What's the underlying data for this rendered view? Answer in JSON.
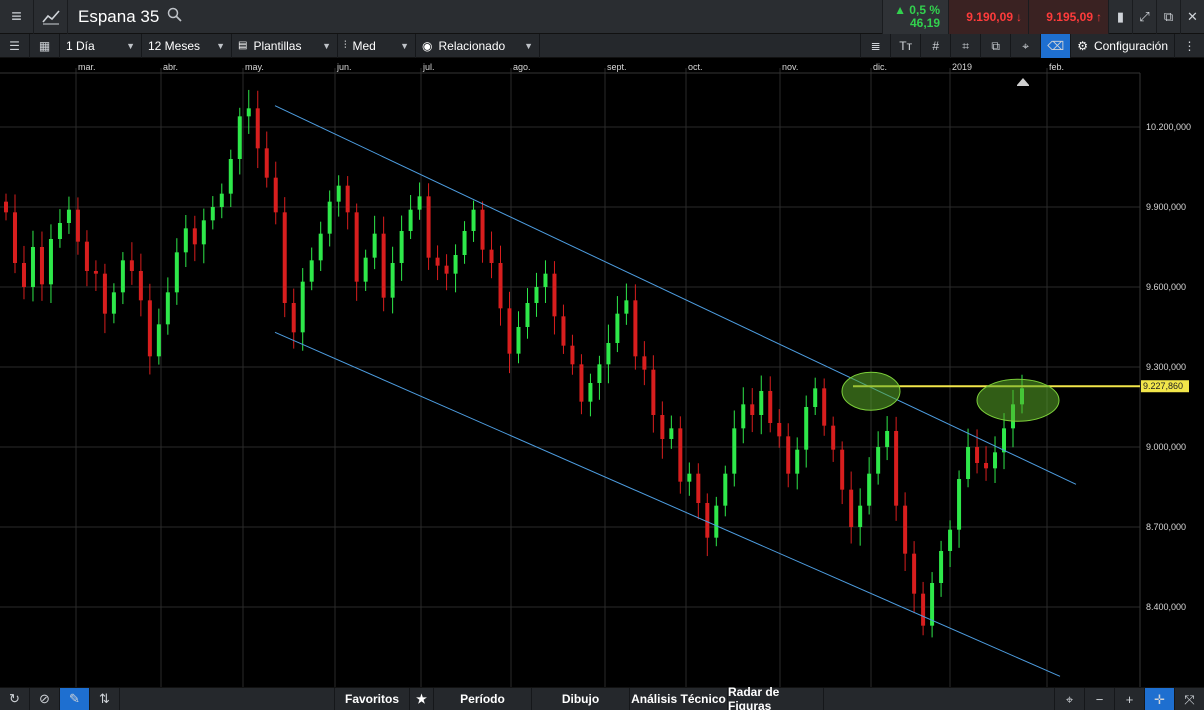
{
  "header": {
    "menu_icon": "hamburger-icon",
    "chart_icon": "line-chart-icon",
    "instrument": "Espana 35",
    "search_icon": "search-icon",
    "change_percent": "▲ 0,5 %",
    "change_points": "46,19",
    "sell_price": "9.190,09",
    "buy_price": "9.195,09",
    "colors": {
      "up": "#32d24e",
      "down": "#ff3b3b"
    }
  },
  "toolbar": {
    "interval": "1 Día",
    "range": "12 Meses",
    "templates": "Plantillas",
    "indicator": "Med",
    "compare": "Relacionado",
    "settings": "Configuración"
  },
  "chart_data": {
    "type": "candlestick",
    "x_ticks": [
      "mar.",
      "abr.",
      "may.",
      "jun.",
      "jul.",
      "ago.",
      "sept.",
      "oct.",
      "nov.",
      "dic.",
      "2019",
      "feb."
    ],
    "y_ticks": [
      "10.200,000",
      "9.900,000",
      "9.600,000",
      "9.300,000",
      "9.000,000",
      "8.700,000",
      "8.400,000"
    ],
    "ylim": [
      8200,
      10400
    ],
    "current_level_label": "9.227,860",
    "current_level": 9227.86,
    "colors": {
      "up": "#2ee84a",
      "down": "#d81e1e",
      "channel": "#4d9de0",
      "level": "#f2e64a",
      "highlight": "#7ccf3a"
    },
    "closes": [
      9880,
      9690,
      9600,
      9750,
      9610,
      9780,
      9840,
      9890,
      9770,
      9660,
      9650,
      9500,
      9580,
      9700,
      9660,
      9550,
      9340,
      9460,
      9580,
      9730,
      9820,
      9760,
      9850,
      9900,
      9950,
      10080,
      10240,
      10270,
      10120,
      10010,
      9880,
      9540,
      9430,
      9620,
      9700,
      9800,
      9920,
      9980,
      9880,
      9620,
      9710,
      9800,
      9560,
      9690,
      9810,
      9890,
      9940,
      9710,
      9680,
      9650,
      9720,
      9810,
      9890,
      9740,
      9690,
      9520,
      9350,
      9450,
      9540,
      9600,
      9650,
      9490,
      9380,
      9310,
      9170,
      9240,
      9310,
      9390,
      9500,
      9550,
      9340,
      9290,
      9120,
      9030,
      9070,
      8870,
      8900,
      8790,
      8660,
      8780,
      8900,
      9070,
      9160,
      9120,
      9210,
      9090,
      9040,
      8900,
      8990,
      9150,
      9220,
      9080,
      8990,
      8840,
      8700,
      8780,
      8900,
      9000,
      9060,
      8780,
      8600,
      8450,
      8330,
      8490,
      8610,
      8690,
      8880,
      9000,
      8940,
      8920,
      8980,
      9070,
      9160,
      9220
    ],
    "date_positions": [
      0.005,
      0.995
    ],
    "channel_upper": [
      [
        10280,
        0
      ],
      [
        8860,
        1
      ]
    ],
    "channel_lower": [
      [
        9430,
        0
      ],
      [
        8140,
        1
      ]
    ]
  },
  "bottombar": {
    "tabs": [
      "Favoritos",
      "Período",
      "Dibujo",
      "Análisis Técnico",
      "Radar de Figuras"
    ]
  }
}
